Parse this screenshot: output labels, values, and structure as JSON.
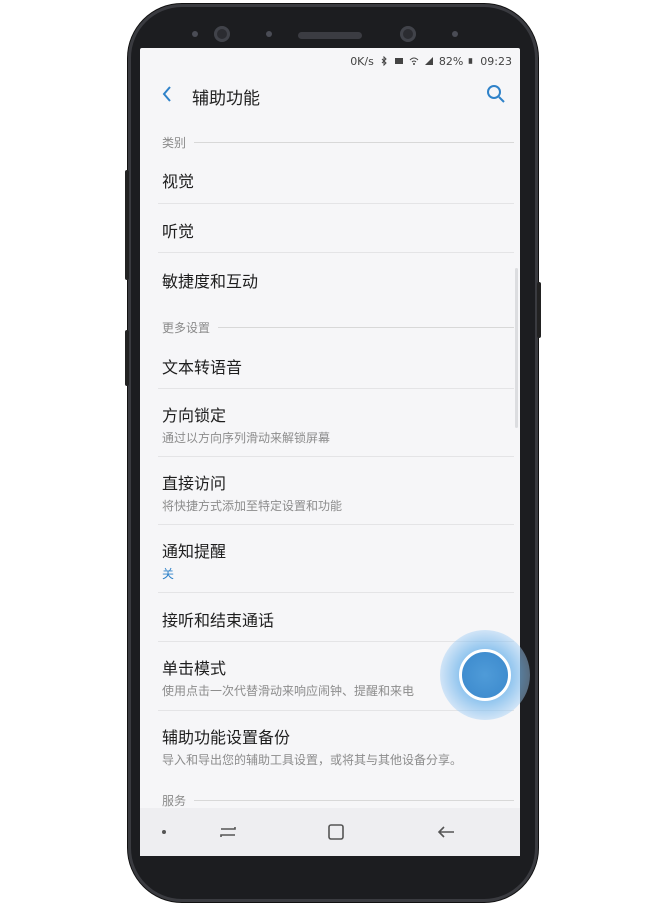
{
  "status_bar": {
    "speed": "0K/s",
    "battery": "82%",
    "time": "09:23"
  },
  "header": {
    "title": "辅助功能"
  },
  "sections": [
    {
      "title": "类别",
      "items": [
        {
          "label": "视觉"
        },
        {
          "label": "听觉"
        },
        {
          "label": "敏捷度和互动"
        }
      ]
    },
    {
      "title": "更多设置",
      "items": [
        {
          "label": "文本转语音"
        },
        {
          "label": "方向锁定",
          "sub": "通过以方向序列滑动来解锁屏幕"
        },
        {
          "label": "直接访问",
          "sub": "将快捷方式添加至特定设置和功能"
        },
        {
          "label": "通知提醒",
          "sub": "关"
        },
        {
          "label": "接听和结束通话"
        },
        {
          "label": "单击模式",
          "sub": "使用点击一次代替滑动来响应闹钟、提醒和来电"
        },
        {
          "label": "辅助功能设置备份",
          "sub": "导入和导出您的辅助工具设置，或将其与其他设备分享。"
        }
      ]
    },
    {
      "title": "服务",
      "items": []
    }
  ],
  "colors": {
    "accent": "#2f82c9",
    "touch": "#4f9bd8"
  },
  "icons": {
    "back": "chevron-left-icon",
    "search": "search-icon",
    "recents": "recents-icon",
    "home": "home-icon",
    "nav_back": "arrow-left-icon"
  }
}
